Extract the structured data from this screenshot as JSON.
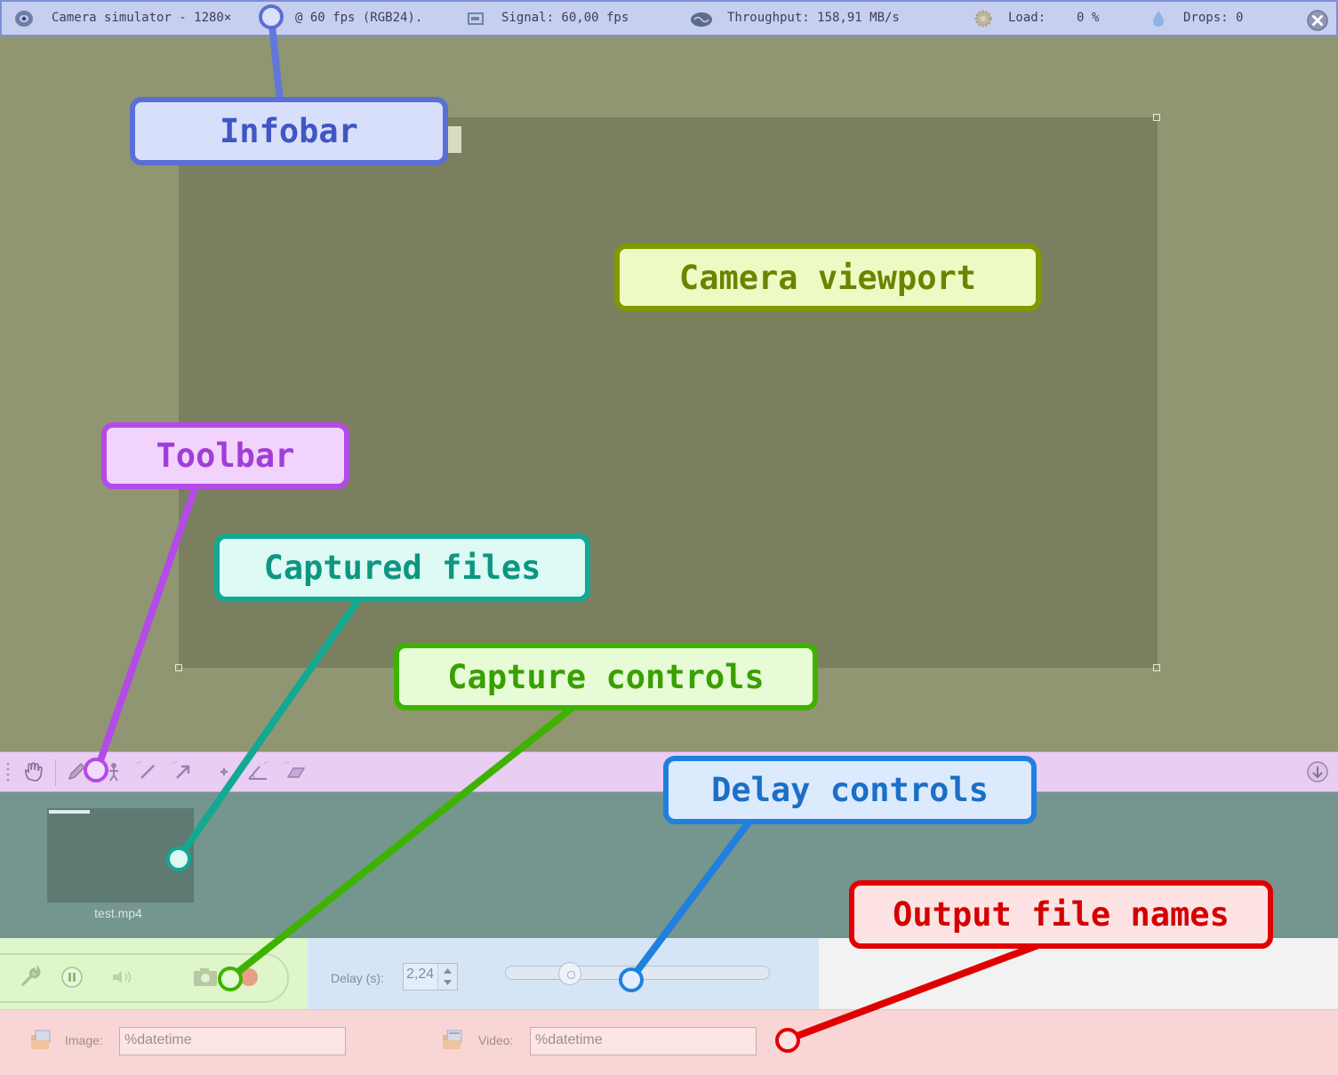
{
  "infobar": {
    "camera_text": "Camera simulator - 1280×",
    "fps_text": "@ 60 fps (RGB24).",
    "signal_text": "Signal: 60,00 fps",
    "throughput_text": "Throughput: 158,91 MB/s",
    "load_label": "Load:",
    "load_value": "0 %",
    "drops_label": "Drops: 0"
  },
  "files": {
    "items": [
      {
        "name": "test.mp4"
      }
    ]
  },
  "delay": {
    "label": "Delay (s):",
    "value": "2,24",
    "slider_fraction": 0.22
  },
  "output": {
    "image_label": "Image:",
    "image_value": "%datetime",
    "video_label": "Video:",
    "video_value": "%datetime"
  },
  "callouts": {
    "infobar": "Infobar",
    "viewport": "Camera viewport",
    "toolbar": "Toolbar",
    "captured_files": "Captured files",
    "capture_controls": "Capture controls",
    "delay_controls": "Delay controls",
    "output_names": "Output file names"
  },
  "colors": {
    "infobar_accent": "#5a6fd6",
    "viewport_accent": "#7f9a00",
    "toolbar_accent": "#b44ae8",
    "captured_files_accent": "#12a892",
    "capture_controls_accent": "#3db300",
    "delay_controls_accent": "#1f80e0",
    "output_names_accent": "#e00000"
  },
  "icons": {
    "infobar": [
      "camera-icon",
      "signal-monitor-icon",
      "brain-icon",
      "gear-load-icon",
      "drop-icon",
      "close-icon"
    ],
    "toolbar": [
      "hand-icon",
      "pencil-icon",
      "person-icon",
      "line-icon",
      "arrow-icon",
      "cross-icon",
      "angle-icon",
      "plane-icon",
      "collapse-icon"
    ],
    "capture": [
      "settings-wrench-icon",
      "pause-icon",
      "speaker-icon",
      "camera-snapshot-icon",
      "record-icon"
    ],
    "output": [
      "image-folder-icon",
      "video-folder-icon"
    ]
  }
}
